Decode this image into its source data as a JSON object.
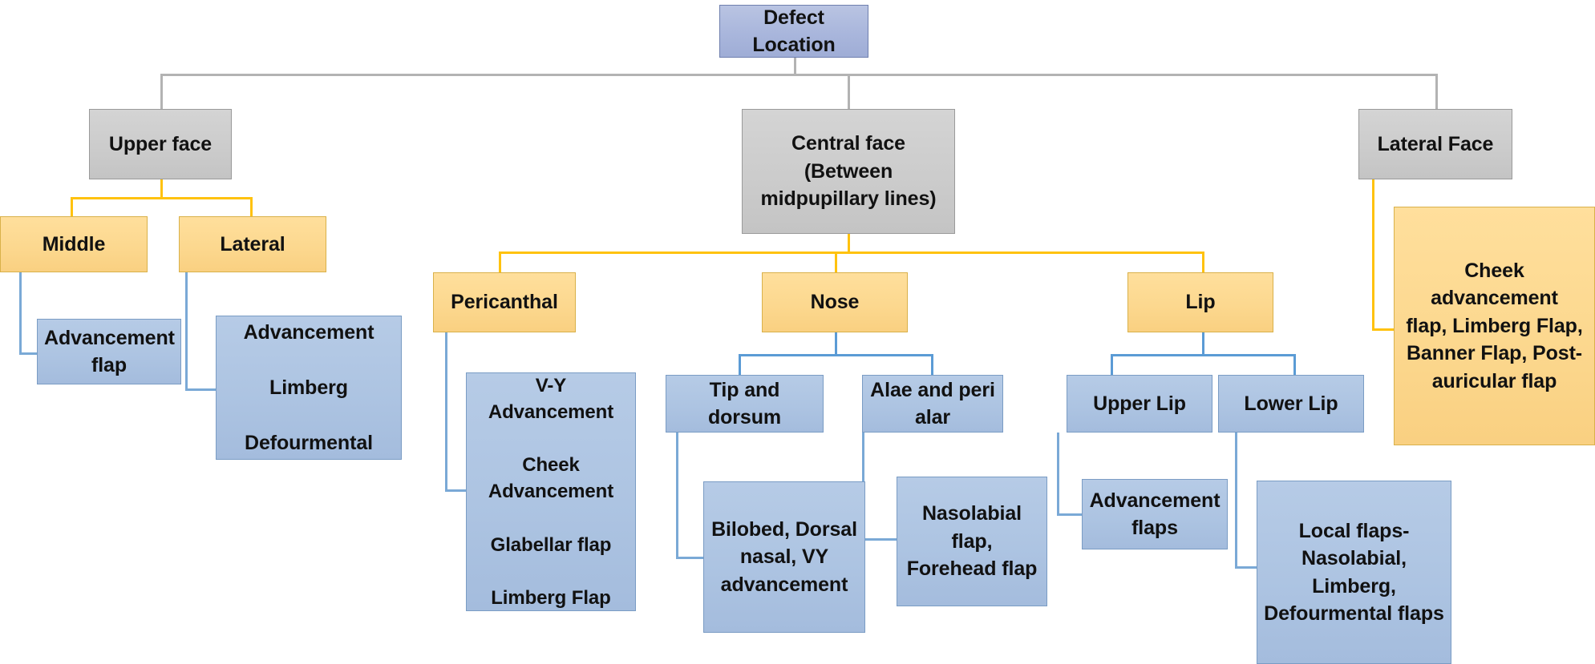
{
  "diagram": {
    "title_node": "Defect Location",
    "colors": {
      "root_fill": "#aab6dc",
      "root_border": "#6f7fae",
      "grey_fill": "#cccccc",
      "grey_border": "#9a9a9a",
      "yellow_fill": "#fbd68c",
      "yellow_border": "#d9b14a",
      "blue_fill": "#adc4e2",
      "blue_border": "#7a9cc4",
      "connector_grey": "#b3b3b3",
      "connector_yellow": "#ffc20e",
      "connector_blue": "#5b9bd5",
      "text": "#111111",
      "background": "#ffffff"
    },
    "root": {
      "label": "Defect Location"
    },
    "branches": {
      "upper_face": {
        "label": "Upper face",
        "children": [
          {
            "label": "Middle",
            "leaf": "Advancement flap"
          },
          {
            "label": "Lateral",
            "leaf": "Advancement\nLimberg\nDefourmental"
          }
        ]
      },
      "central_face": {
        "label": "Central face (Between midpupillary lines)",
        "children": [
          {
            "label": "Pericanthal",
            "leaf": "V-Y Advancement\nCheek Advancement\nGlabellar flap\nLimberg Flap"
          },
          {
            "label": "Nose",
            "subchildren": [
              {
                "label": "Tip and dorsum",
                "leaf": "Bilobed, Dorsal nasal, VY advancement"
              },
              {
                "label": "Alae and peri alar",
                "leaf": "Nasolabial flap, Forehead flap"
              }
            ]
          },
          {
            "label": "Lip",
            "subchildren": [
              {
                "label": "Upper Lip",
                "leaf": "Advancement flaps"
              },
              {
                "label": "Lower Lip",
                "leaf": "Local flaps- Nasolabial, Limberg, Defourmental flaps"
              }
            ]
          }
        ]
      },
      "lateral_face": {
        "label": "Lateral Face",
        "leaf": "Cheek advancement flap, Limberg Flap, Banner Flap, Post-auricular flap"
      }
    },
    "lines": {
      "upper_face_lateral_l1": "Advancement",
      "upper_face_lateral_l2": "Limberg",
      "upper_face_lateral_l3": "Defourmental",
      "pericanthal_l1": "V-Y Advancement",
      "pericanthal_l2a": "Cheek",
      "pericanthal_l2b": "Advancement",
      "pericanthal_l3": "Glabellar flap",
      "pericanthal_l4": "Limberg Flap",
      "central_face_l1": "Central face (Between",
      "central_face_l2": "midpupillary lines)",
      "alae_l1": "Alae and peri",
      "alae_l2": "alar",
      "tip_leaf_l1": "Bilobed, Dorsal",
      "tip_leaf_l2": "nasal, VY",
      "tip_leaf_l3": "advancement",
      "alae_leaf_l1": "Nasolabial flap,",
      "alae_leaf_l2": "Forehead flap",
      "upper_lip_leaf_l1": "Advancement",
      "upper_lip_leaf_l2": "flaps",
      "lower_lip_leaf_l1": "Local flaps-",
      "lower_lip_leaf_l2": "Nasolabial, Limberg,",
      "lower_lip_leaf_l3": "Defourmental flaps",
      "lateral_leaf_l1": "Cheek advancement",
      "lateral_leaf_l2": "flap, Limberg Flap,",
      "lateral_leaf_l3": "Banner Flap, Post-",
      "lateral_leaf_l4": "auricular flap",
      "middle_leaf_l1": "Advancement",
      "middle_leaf_l2": "flap"
    }
  }
}
